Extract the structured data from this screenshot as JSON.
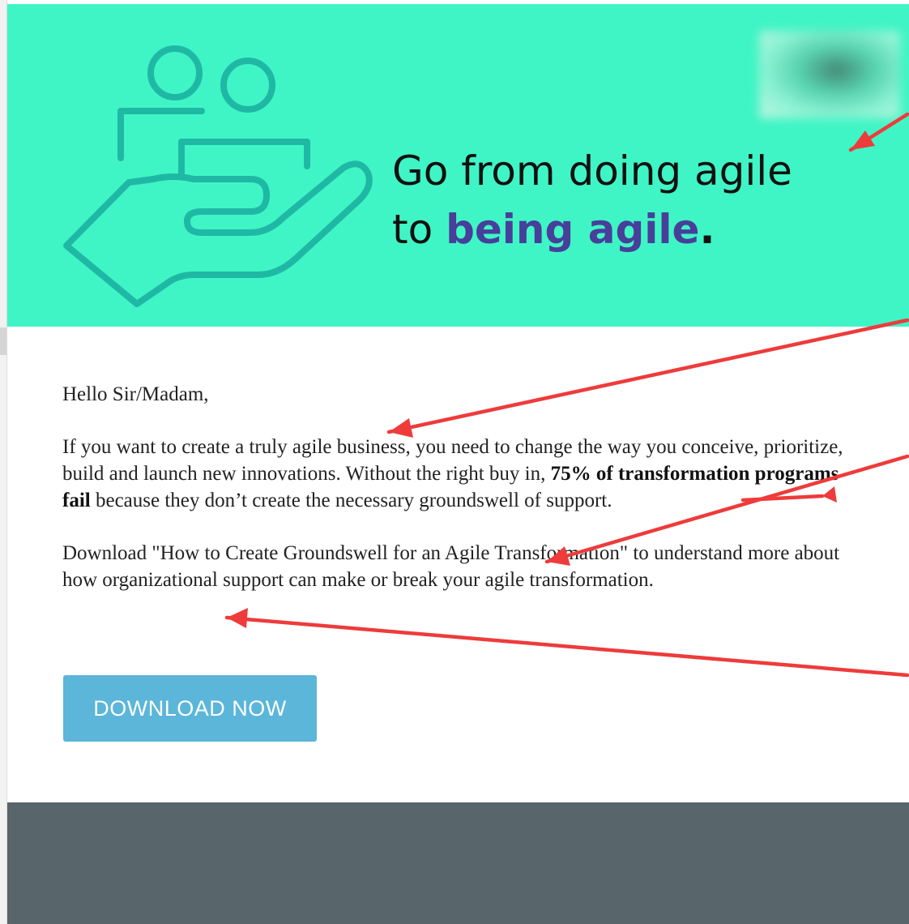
{
  "hero": {
    "headline_line1": "Go from doing agile",
    "headline_line2_prefix": "to ",
    "headline_accent": "being agile",
    "headline_suffix": ".",
    "background_color": "#3ff5c5",
    "accent_color": "#473f9a",
    "illustration_icon": "hand-holding-people-icon",
    "logo": "blurred-logo"
  },
  "email": {
    "greeting": "Hello Sir/Madam,",
    "paragraph1_lead": "If you want to create a truly agile business, you need to change the way you conceive, prioritize, build and launch new innovations. Without the right buy in, ",
    "paragraph1_bold": "75% of transformation programs fail",
    "paragraph1_tail": " because they don’t create the necessary groundswell of support.",
    "paragraph2": "Download \"How to Create Groundswell for an Agile Transformation\" to understand more about how organizational support can make or break your agile transformation."
  },
  "cta": {
    "label": "DOWNLOAD NOW",
    "color": "#5bb6d9"
  },
  "footer": {
    "color": "#58656b"
  },
  "annotations": {
    "arrow_color": "#ee3b3b",
    "arrow_icon": "red-arrow-icon"
  }
}
